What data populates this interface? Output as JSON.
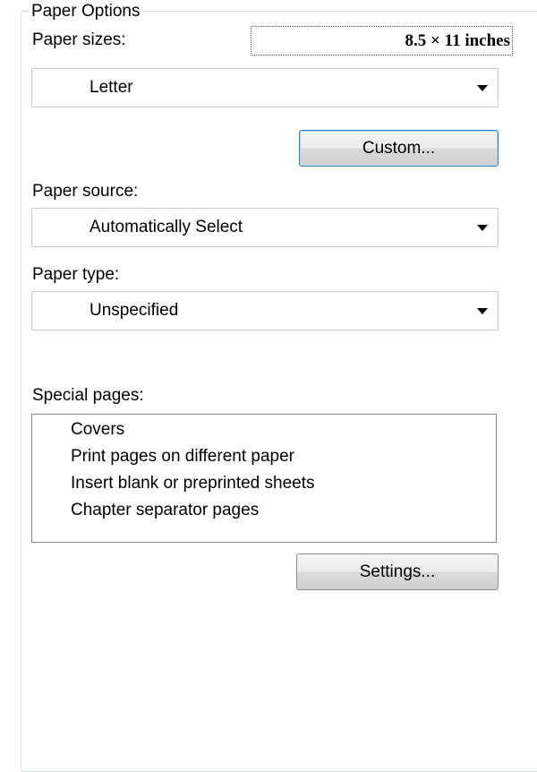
{
  "group": {
    "title": "Paper Options"
  },
  "paper_sizes": {
    "label": "Paper sizes:",
    "dimensions": "8.5 × 11 inches",
    "selected": "Letter",
    "custom_button": "Custom..."
  },
  "paper_source": {
    "label": "Paper source:",
    "selected": "Automatically Select"
  },
  "paper_type": {
    "label": "Paper type:",
    "selected": "Unspecified"
  },
  "special_pages": {
    "label": "Special pages:",
    "items": [
      "Covers",
      "Print pages on different paper",
      "Insert blank or preprinted sheets",
      "Chapter separator pages"
    ],
    "settings_button": "Settings..."
  }
}
